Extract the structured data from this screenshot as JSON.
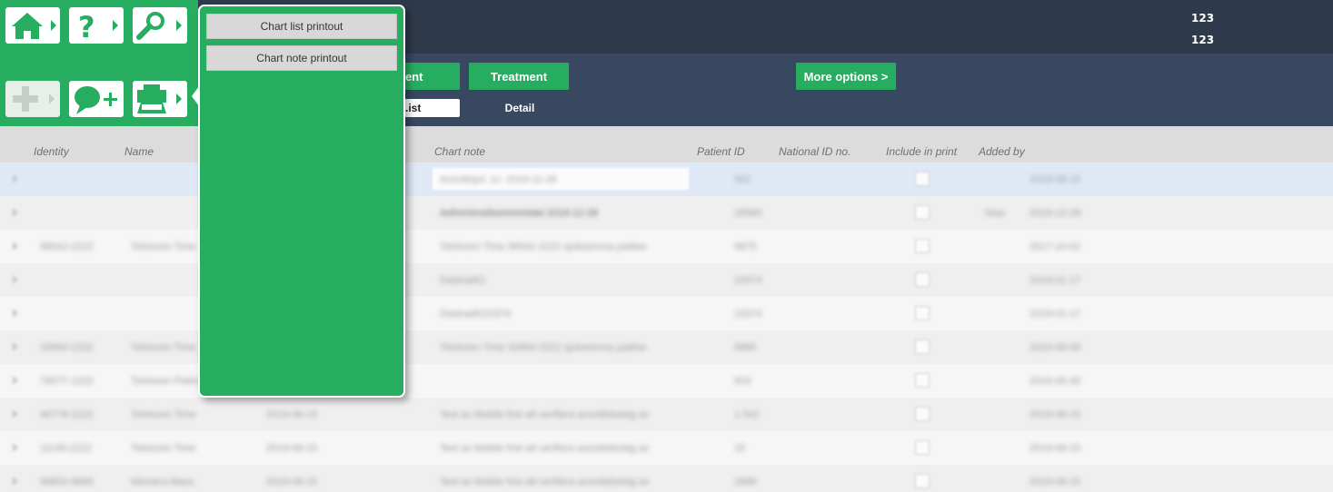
{
  "header": {
    "counters": [
      "123",
      "123"
    ],
    "buttons": {
      "patient": "tient",
      "treatment": "Treatment",
      "more": "More options >"
    },
    "tabs": {
      "list": ".ist",
      "detail": "Detail"
    }
  },
  "dropdown": {
    "items": [
      "Chart list printout",
      "Chart note printout"
    ]
  },
  "tools": [
    {
      "icon": "home-icon"
    },
    {
      "icon": "help-icon"
    },
    {
      "icon": "search-icon"
    },
    {
      "icon": "add-icon"
    },
    {
      "icon": "add-note-icon"
    },
    {
      "icon": "print-icon"
    }
  ],
  "table": {
    "columns": [
      "Identity",
      "Name",
      "Chart note",
      "Patient ID",
      "National ID no.",
      "Include in print",
      "Added by"
    ],
    "rows": [
      {
        "identity": "",
        "name": "",
        "date": "",
        "note": "Avsnittsjnl. 1c: 2019-11-28",
        "pid": "502",
        "added": "",
        "time": "2019-08-15"
      },
      {
        "identity": "",
        "name": "",
        "date": "",
        "note": "Avfmmimsilsommmistel 2019-12-28",
        "pid": "28580",
        "added": "Nias",
        "time": "2019-12-28"
      },
      {
        "identity": "98542-2222",
        "name": "Tolvtoren Time",
        "date": "",
        "note": "Tolvtoren Time 98542-2222 sjuksemma patitse",
        "pid": "9875",
        "added": "",
        "time": "2017-10-02"
      },
      {
        "identity": "",
        "name": "",
        "date": "",
        "note": "Dastrad61",
        "pid": "23374",
        "added": "",
        "time": "2019-01-17"
      },
      {
        "identity": "",
        "name": "",
        "date": "",
        "note": "Dastrad61/2374",
        "pid": "23374",
        "added": "",
        "time": "2019-01-17"
      },
      {
        "identity": "33894-2222",
        "name": "Tolvtoren Time",
        "date": "",
        "note": "Tolvtoren Time 33894-2222 sjuksemma patitse",
        "pid": "9885",
        "added": "",
        "time": "2019-08-08"
      },
      {
        "identity": "78077-1222",
        "name": "Tolvtoren Pekka",
        "date": "",
        "note": "",
        "pid": "903",
        "added": "",
        "time": "2019-05-30"
      },
      {
        "identity": "46778-2222",
        "name": "Tolvtoren Time",
        "date": "2019-08-15",
        "note": "Test av Mobile frist att verifiera avsnittsbolag av",
        "pid": "1 542",
        "added": "",
        "time": "2019-08-15"
      },
      {
        "identity": "11148-2222",
        "name": "Tolvtoren Time",
        "date": "2019-08-15",
        "note": "Test av Mobile frist att verifiera avsnittsbolag av",
        "pid": "15",
        "added": "",
        "time": "2019-08-15"
      },
      {
        "identity": "98854-9899",
        "name": "Momera Mass",
        "date": "2019-08-15",
        "note": "Test av Mobile frist att verifiera avsnittsbolag av",
        "pid": "2889",
        "added": "",
        "time": "2019-08-15"
      }
    ]
  }
}
